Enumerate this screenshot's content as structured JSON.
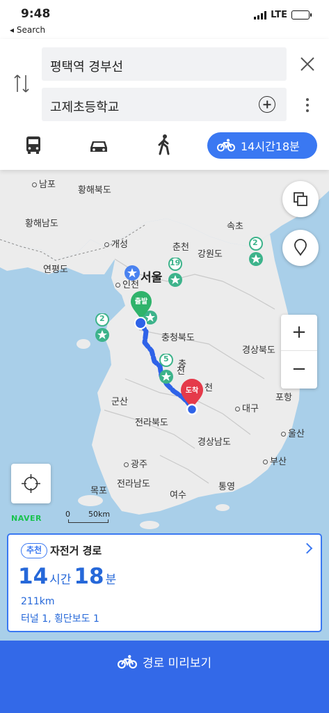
{
  "status_bar": {
    "time": "9:48",
    "back_label": "◂ Search",
    "network": "LTE"
  },
  "search": {
    "origin": "평택역 경부선",
    "destination": "고제초등학교"
  },
  "modes": {
    "active_label": "14시간18분",
    "accent": "#3a78f2"
  },
  "map": {
    "places": {
      "nampo": "남포",
      "hwanghae_n": "황해북도",
      "hwanghae_s": "황해남도",
      "kaesong": "개성",
      "yeonpyeong": "연평도",
      "incheon": "인천",
      "seoul": "서울",
      "chuncheon": "춘천",
      "gangwon": "강원도",
      "sokcho": "속초",
      "chungbuk": "충청북도",
      "gyeongbuk": "경상북도",
      "daejeon_part": "전",
      "gimcheon_part": "천",
      "gunsan": "군산",
      "daegu": "대구",
      "pohang": "포항",
      "jeonbuk": "전라북도",
      "ulsan": "울산",
      "gyeongnam": "경상남도",
      "busan": "부산",
      "gwangju": "광주",
      "mokpo": "목포",
      "jeonnam": "전라남도",
      "yeosu": "여수",
      "tongyeong": "통영",
      "chungnam_part": "충"
    },
    "markers": {
      "start_label": "출발",
      "end_label": "도착",
      "cluster_a": "2",
      "cluster_b": "19",
      "cluster_c": "2",
      "cluster_d": "5",
      "cluster_e": "2"
    },
    "brand": "NAVER",
    "scale_start": "0",
    "scale_end": "50km"
  },
  "route_card": {
    "badge": "추천",
    "title": "자전거 경로",
    "hours": "14",
    "hours_unit": "시간",
    "minutes": "18",
    "minutes_unit": "분",
    "distance": "211km",
    "extra": "터널 1, 횡단보도 1"
  },
  "preview_button": {
    "label": "경로 미리보기"
  }
}
